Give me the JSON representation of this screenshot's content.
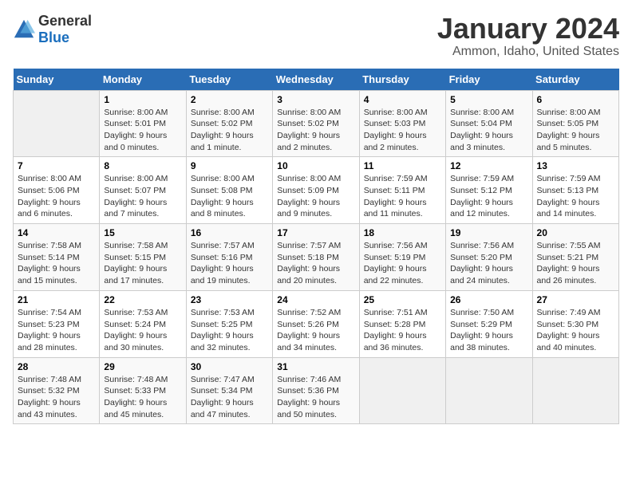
{
  "header": {
    "logo_general": "General",
    "logo_blue": "Blue",
    "title": "January 2024",
    "subtitle": "Ammon, Idaho, United States"
  },
  "days_of_week": [
    "Sunday",
    "Monday",
    "Tuesday",
    "Wednesday",
    "Thursday",
    "Friday",
    "Saturday"
  ],
  "weeks": [
    [
      {
        "day": "",
        "info": ""
      },
      {
        "day": "1",
        "info": "Sunrise: 8:00 AM\nSunset: 5:01 PM\nDaylight: 9 hours\nand 0 minutes."
      },
      {
        "day": "2",
        "info": "Sunrise: 8:00 AM\nSunset: 5:02 PM\nDaylight: 9 hours\nand 1 minute."
      },
      {
        "day": "3",
        "info": "Sunrise: 8:00 AM\nSunset: 5:02 PM\nDaylight: 9 hours\nand 2 minutes."
      },
      {
        "day": "4",
        "info": "Sunrise: 8:00 AM\nSunset: 5:03 PM\nDaylight: 9 hours\nand 2 minutes."
      },
      {
        "day": "5",
        "info": "Sunrise: 8:00 AM\nSunset: 5:04 PM\nDaylight: 9 hours\nand 3 minutes."
      },
      {
        "day": "6",
        "info": "Sunrise: 8:00 AM\nSunset: 5:05 PM\nDaylight: 9 hours\nand 5 minutes."
      }
    ],
    [
      {
        "day": "7",
        "info": "Sunrise: 8:00 AM\nSunset: 5:06 PM\nDaylight: 9 hours\nand 6 minutes."
      },
      {
        "day": "8",
        "info": "Sunrise: 8:00 AM\nSunset: 5:07 PM\nDaylight: 9 hours\nand 7 minutes."
      },
      {
        "day": "9",
        "info": "Sunrise: 8:00 AM\nSunset: 5:08 PM\nDaylight: 9 hours\nand 8 minutes."
      },
      {
        "day": "10",
        "info": "Sunrise: 8:00 AM\nSunset: 5:09 PM\nDaylight: 9 hours\nand 9 minutes."
      },
      {
        "day": "11",
        "info": "Sunrise: 7:59 AM\nSunset: 5:11 PM\nDaylight: 9 hours\nand 11 minutes."
      },
      {
        "day": "12",
        "info": "Sunrise: 7:59 AM\nSunset: 5:12 PM\nDaylight: 9 hours\nand 12 minutes."
      },
      {
        "day": "13",
        "info": "Sunrise: 7:59 AM\nSunset: 5:13 PM\nDaylight: 9 hours\nand 14 minutes."
      }
    ],
    [
      {
        "day": "14",
        "info": "Sunrise: 7:58 AM\nSunset: 5:14 PM\nDaylight: 9 hours\nand 15 minutes."
      },
      {
        "day": "15",
        "info": "Sunrise: 7:58 AM\nSunset: 5:15 PM\nDaylight: 9 hours\nand 17 minutes."
      },
      {
        "day": "16",
        "info": "Sunrise: 7:57 AM\nSunset: 5:16 PM\nDaylight: 9 hours\nand 19 minutes."
      },
      {
        "day": "17",
        "info": "Sunrise: 7:57 AM\nSunset: 5:18 PM\nDaylight: 9 hours\nand 20 minutes."
      },
      {
        "day": "18",
        "info": "Sunrise: 7:56 AM\nSunset: 5:19 PM\nDaylight: 9 hours\nand 22 minutes."
      },
      {
        "day": "19",
        "info": "Sunrise: 7:56 AM\nSunset: 5:20 PM\nDaylight: 9 hours\nand 24 minutes."
      },
      {
        "day": "20",
        "info": "Sunrise: 7:55 AM\nSunset: 5:21 PM\nDaylight: 9 hours\nand 26 minutes."
      }
    ],
    [
      {
        "day": "21",
        "info": "Sunrise: 7:54 AM\nSunset: 5:23 PM\nDaylight: 9 hours\nand 28 minutes."
      },
      {
        "day": "22",
        "info": "Sunrise: 7:53 AM\nSunset: 5:24 PM\nDaylight: 9 hours\nand 30 minutes."
      },
      {
        "day": "23",
        "info": "Sunrise: 7:53 AM\nSunset: 5:25 PM\nDaylight: 9 hours\nand 32 minutes."
      },
      {
        "day": "24",
        "info": "Sunrise: 7:52 AM\nSunset: 5:26 PM\nDaylight: 9 hours\nand 34 minutes."
      },
      {
        "day": "25",
        "info": "Sunrise: 7:51 AM\nSunset: 5:28 PM\nDaylight: 9 hours\nand 36 minutes."
      },
      {
        "day": "26",
        "info": "Sunrise: 7:50 AM\nSunset: 5:29 PM\nDaylight: 9 hours\nand 38 minutes."
      },
      {
        "day": "27",
        "info": "Sunrise: 7:49 AM\nSunset: 5:30 PM\nDaylight: 9 hours\nand 40 minutes."
      }
    ],
    [
      {
        "day": "28",
        "info": "Sunrise: 7:48 AM\nSunset: 5:32 PM\nDaylight: 9 hours\nand 43 minutes."
      },
      {
        "day": "29",
        "info": "Sunrise: 7:48 AM\nSunset: 5:33 PM\nDaylight: 9 hours\nand 45 minutes."
      },
      {
        "day": "30",
        "info": "Sunrise: 7:47 AM\nSunset: 5:34 PM\nDaylight: 9 hours\nand 47 minutes."
      },
      {
        "day": "31",
        "info": "Sunrise: 7:46 AM\nSunset: 5:36 PM\nDaylight: 9 hours\nand 50 minutes."
      },
      {
        "day": "",
        "info": ""
      },
      {
        "day": "",
        "info": ""
      },
      {
        "day": "",
        "info": ""
      }
    ]
  ]
}
